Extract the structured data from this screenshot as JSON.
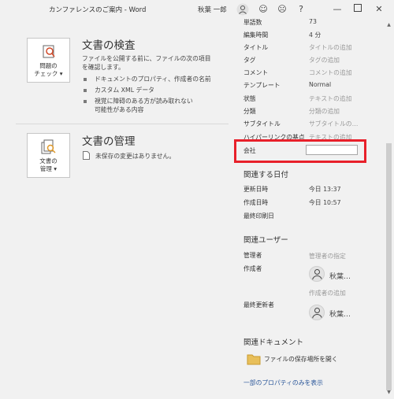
{
  "window": {
    "title": "カンファレンスのご案内 - Word",
    "user": "秋葉 一郎",
    "help_label": "?"
  },
  "inspect": {
    "button_label": "問題の\nチェック ▾",
    "title": "文書の検査",
    "description": "ファイルを公開する前に、ファイルの次の項目\nを確認します。",
    "bullets": [
      "ドキュメントのプロパティ、作成者の名前",
      "カスタム XML データ",
      "視覚に障碍のある方が読み取れない\n可能性がある内容"
    ]
  },
  "manage": {
    "button_label": "文書の\n管理 ▾",
    "title": "文書の管理",
    "status": "未保存の変更はありません。"
  },
  "properties": {
    "items": [
      {
        "label": "単語数",
        "value": "73"
      },
      {
        "label": "編集時間",
        "value": "4 分"
      },
      {
        "label": "タイトル",
        "value": "タイトルの追加"
      },
      {
        "label": "タグ",
        "value": "タグの追加"
      },
      {
        "label": "コメント",
        "value": "コメントの追加"
      },
      {
        "label": "テンプレート",
        "value": "Normal"
      },
      {
        "label": "状態",
        "value": "テキストの追加"
      },
      {
        "label": "分類",
        "value": "分類の追加"
      },
      {
        "label": "サブタイトル",
        "value": "サブタイトルの…"
      },
      {
        "label": "ハイパーリンクの基点",
        "value": "テキストの追加"
      }
    ],
    "company_label": "会社",
    "company_value": ""
  },
  "related_dates": {
    "heading": "関連する日付",
    "items": [
      {
        "label": "更新日時",
        "value": "今日 13:37"
      },
      {
        "label": "作成日時",
        "value": "今日 10:57"
      },
      {
        "label": "最終印刷日",
        "value": ""
      }
    ]
  },
  "related_people": {
    "heading": "関連ユーザー",
    "manager_label": "管理者",
    "manager_placeholder": "管理者の指定",
    "author_label": "作成者",
    "author_name": "秋葉…",
    "author_add": "作成者の追加",
    "last_modified_label": "最終更新者",
    "last_modified_name": "秋葉…"
  },
  "related_docs": {
    "heading": "関連ドキュメント",
    "open_location": "ファイルの保存場所を開く",
    "show_fewer": "一部のプロパティのみを表示"
  },
  "colors": {
    "highlight": "#e8202a",
    "link": "#2b579a"
  }
}
